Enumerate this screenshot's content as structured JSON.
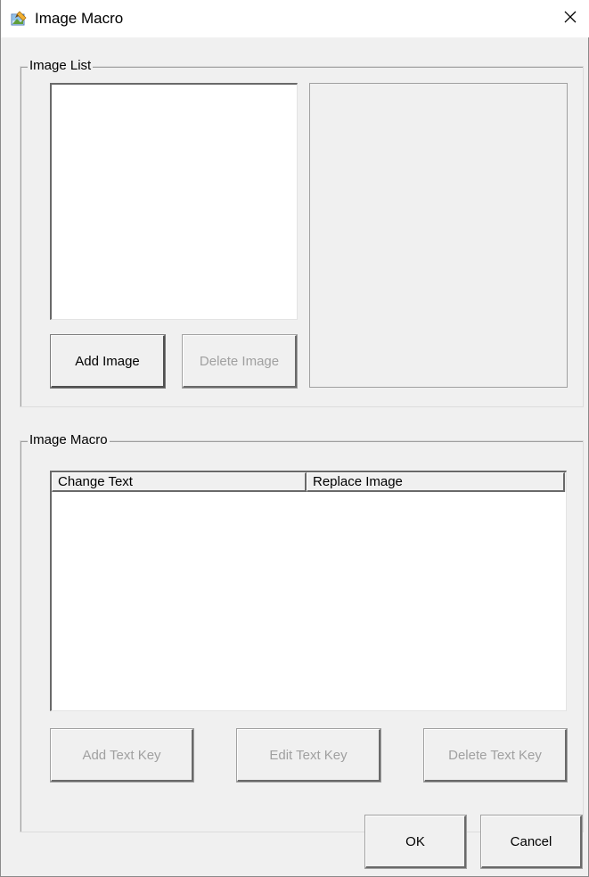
{
  "window": {
    "title": "Image Macro",
    "app_icon": "image-macro-app-icon",
    "close_icon": "close-icon"
  },
  "image_list": {
    "group_label": "Image List",
    "add_button": "Add Image",
    "delete_button": "Delete Image"
  },
  "image_macro": {
    "group_label": "Image Macro",
    "columns": [
      "Change Text",
      "Replace Image"
    ],
    "rows": [],
    "add_button": "Add Text Key",
    "edit_button": "Edit Text Key",
    "delete_button": "Delete Text Key"
  },
  "footer": {
    "ok_button": "OK",
    "cancel_button": "Cancel"
  }
}
